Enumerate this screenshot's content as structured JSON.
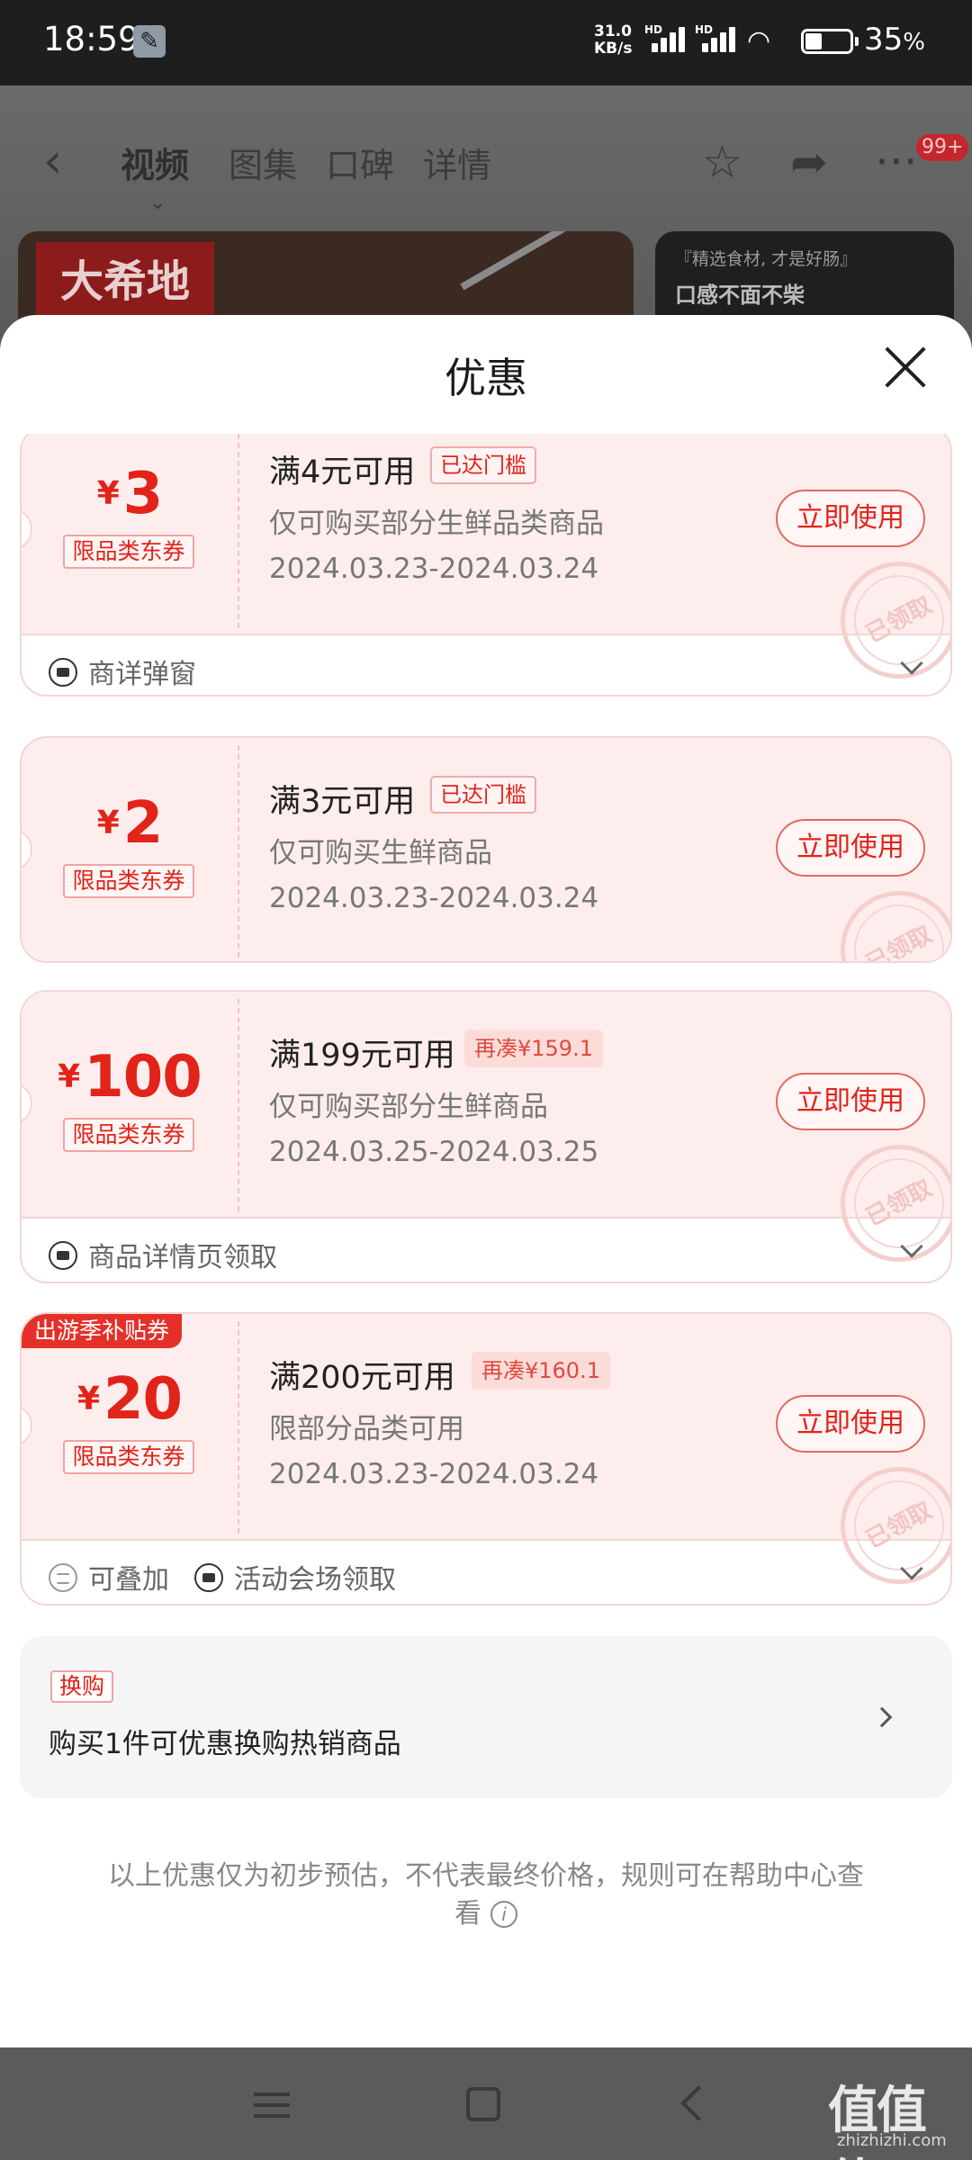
{
  "status_bar": {
    "time": "18:59",
    "net_speed_value": "31.0",
    "net_speed_unit": "KB/s",
    "battery": "35",
    "battery_unit": "%",
    "battery_level": 0.35,
    "icons": [
      "wrench-icon",
      "signal-icon",
      "wifi-icon",
      "battery-icon"
    ]
  },
  "product_nav": {
    "tabs": [
      {
        "label": "视频",
        "active": true
      },
      {
        "label": "图集",
        "active": false
      },
      {
        "label": "口碑",
        "active": false
      },
      {
        "label": "详情",
        "active": false
      }
    ],
    "badge": "99+",
    "icons": [
      "back-icon",
      "star-icon",
      "share-icon",
      "more-icon"
    ]
  },
  "banners": {
    "left_logo": "大希地",
    "right_subtitle": "『精选食材, 才是好肠』",
    "right_title": "口感不面不柴"
  },
  "sheet": {
    "title": "优惠",
    "close_icon": "close-icon"
  },
  "coupons": [
    {
      "currency": "¥",
      "amount": "3",
      "category_tag": "限品类东券",
      "title": "满4元可用",
      "badge": "已达门槛",
      "desc": "仅可购买部分生鲜品类商品",
      "date": "2024.03.23-2024.03.24",
      "button": "立即使用",
      "stamp": "已领取",
      "footer": [
        {
          "icon": "ticket-icon",
          "label": "商详弹窗"
        }
      ]
    },
    {
      "currency": "¥",
      "amount": "2",
      "category_tag": "限品类东券",
      "title": "满3元可用",
      "badge": "已达门槛",
      "desc": "仅可购买生鲜商品",
      "date": "2024.03.23-2024.03.24",
      "button": "立即使用",
      "stamp": "已领取",
      "footer": []
    },
    {
      "currency": "¥",
      "amount": "100",
      "category_tag": "限品类东券",
      "title": "满199元可用",
      "badge": "再凑¥159.1",
      "desc": "仅可购买部分生鲜商品",
      "date": "2024.03.25-2024.03.25",
      "button": "立即使用",
      "stamp": "已领取",
      "footer": [
        {
          "icon": "ticket-icon",
          "label": "商品详情页领取"
        }
      ]
    },
    {
      "ribbon": "出游季补贴券",
      "currency": "¥",
      "amount": "20",
      "category_tag": "限品类东券",
      "title": "满200元可用",
      "badge": "再凑¥160.1",
      "desc": "限部分品类可用",
      "date": "2024.03.23-2024.03.24",
      "button": "立即使用",
      "stamp": "已领取",
      "footer": [
        {
          "icon": "stack-icon",
          "label": "可叠加"
        },
        {
          "icon": "ticket-icon",
          "label": "活动会场领取"
        }
      ]
    }
  ],
  "exchange": {
    "tag": "换购",
    "text": "购买1件可优惠换购热销商品"
  },
  "note": {
    "text": "以上优惠仅为初步预估，不代表最终价格，规则可在帮助中心查看",
    "icon": "info-icon"
  },
  "watermark": {
    "text": "值值值",
    "sub": "zhizhizhi.com"
  },
  "colors": {
    "accent": "#e2231a",
    "card_bg": "#fdeeed",
    "card_border": "#f5d5d5"
  }
}
